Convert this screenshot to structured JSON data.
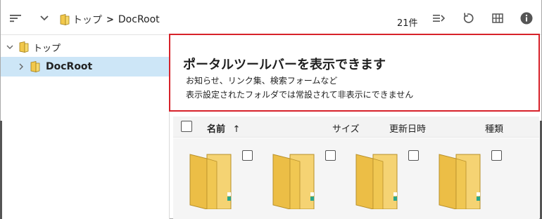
{
  "toolbar": {
    "breadcrumb_root": "トップ",
    "breadcrumb_separator": ">",
    "breadcrumb_current": "DocRoot",
    "item_count": "21件"
  },
  "tree": {
    "items": [
      {
        "label": "トップ",
        "expanded": true,
        "selected": false
      },
      {
        "label": "DocRoot",
        "expanded": false,
        "selected": true
      }
    ]
  },
  "banner": {
    "title": "ポータルツールバーを表示できます",
    "line1": "お知らせ、リンク集、検索フォームなど",
    "line2": "表示設定されたフォルダでは常設されて非表示にできません",
    "border_color": "#d7222a"
  },
  "list_header": {
    "name": "名前",
    "sort_arrow": "↑",
    "size": "サイズ",
    "modified": "更新日時",
    "type": "種類"
  },
  "colors": {
    "selection": "#cde6f7",
    "folder": "#f2c84b",
    "accent": "#d7222a"
  },
  "icons": [
    "sort-icon",
    "chevron-down-icon",
    "folder-icon",
    "list-view-icon",
    "refresh-icon",
    "grid-view-icon",
    "info-icon",
    "checkbox-icon"
  ]
}
